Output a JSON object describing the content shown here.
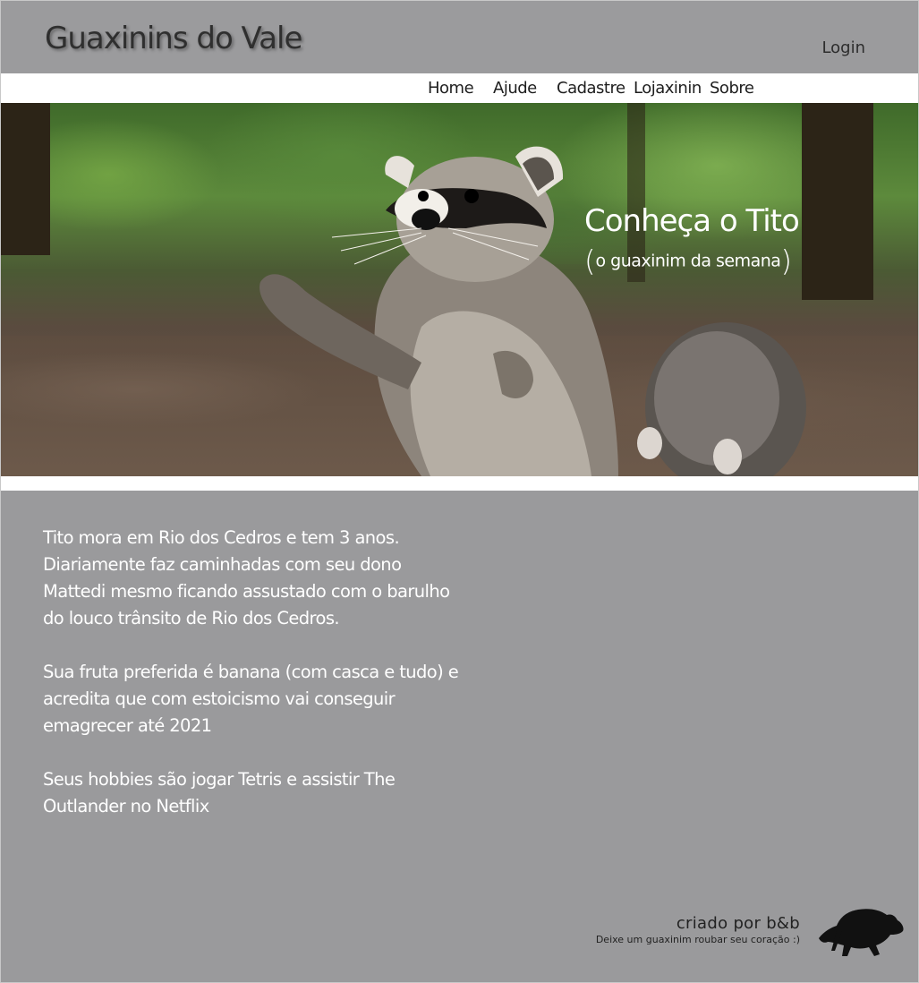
{
  "header": {
    "site_title": "Guaxinins do Vale",
    "login_label": "Login"
  },
  "nav": {
    "items": [
      {
        "label": "Home"
      },
      {
        "label": "Ajude"
      },
      {
        "label": "Cadastre"
      },
      {
        "label": "Lojaxinin"
      },
      {
        "label": "Sobre"
      }
    ]
  },
  "hero": {
    "title": "Conheça o Tito",
    "subtitle_open": "(",
    "subtitle": "o guaxinim da semana",
    "subtitle_close": ")",
    "image": "raccoon-photo"
  },
  "content": {
    "paragraphs": [
      "Tito mora em Rio dos Cedros e tem 3 anos. Diariamente faz caminhadas com seu dono Mattedi mesmo ficando assustado com o barulho do louco trânsito de Rio dos Cedros.",
      "Sua fruta preferida é banana (com casca e tudo) e acredita que com estoicismo vai conseguir emagrecer até 2021",
      "Seus hobbies são  jogar Tetris e assistir The Outlander no Netflix"
    ]
  },
  "footer": {
    "credit": "criado por b&b",
    "tagline": "Deixe um guaxinim roubar seu coração :)",
    "logo": "raccoon-silhouette-icon"
  },
  "colors": {
    "header_bg": "#9b9b9d",
    "content_bg": "#9a9a9c",
    "text_light": "#ffffff",
    "text_dark": "#2f2f2f"
  }
}
